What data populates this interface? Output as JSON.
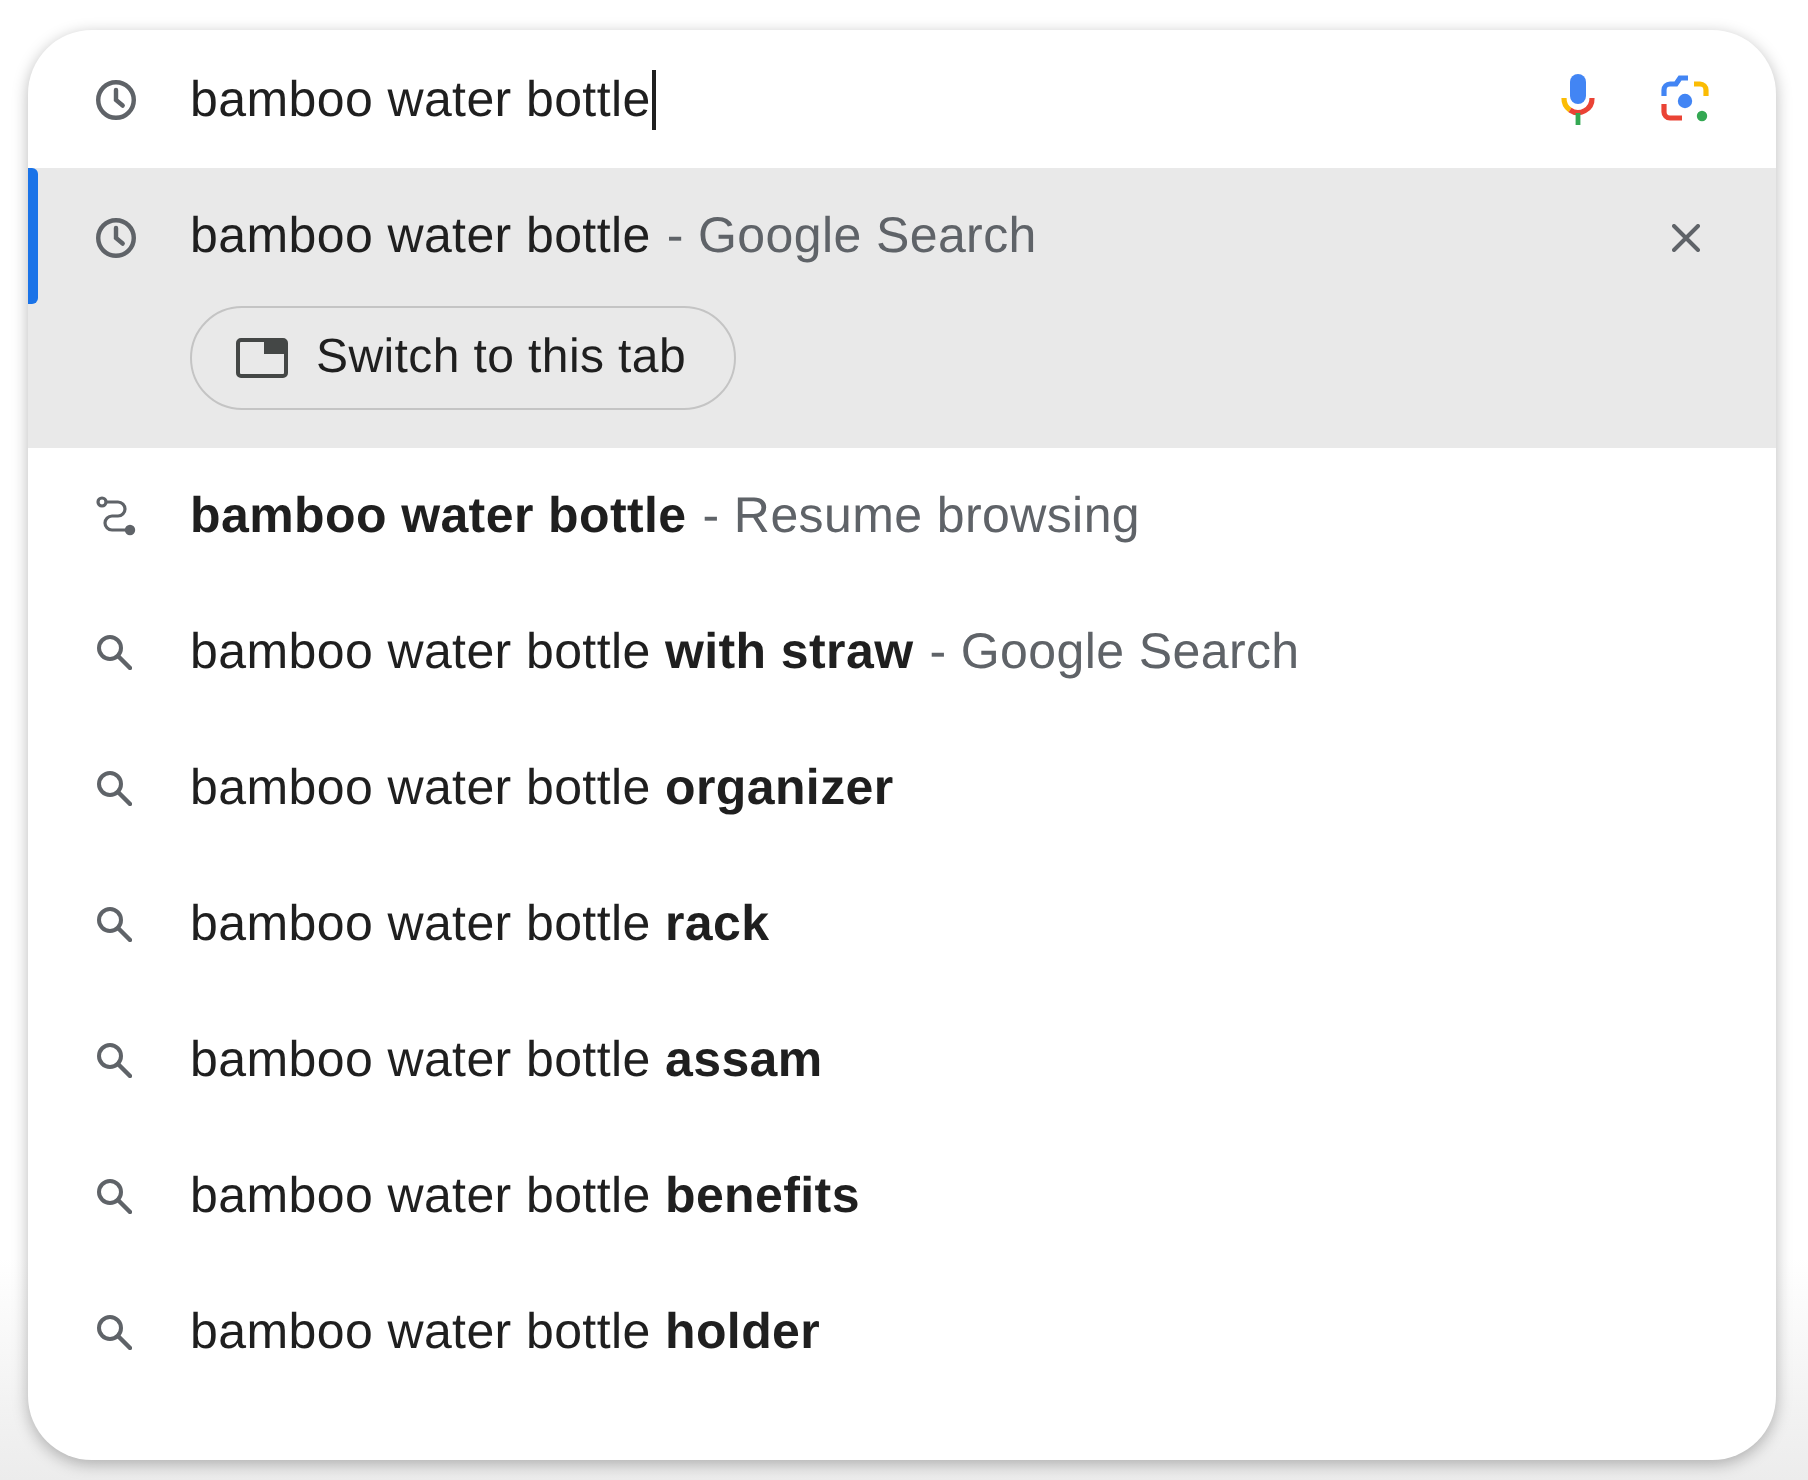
{
  "search_box": {
    "value": "bamboo water bottle",
    "focused": true
  },
  "suggestions": [
    {
      "kind": "history",
      "text": "bamboo water bottle",
      "bold": false,
      "description": "- Google Search",
      "selected": true,
      "action": "Switch to this tab"
    },
    {
      "kind": "journey",
      "text": "bamboo water bottle",
      "bold": true,
      "description": "- Resume browsing",
      "selected": false
    },
    {
      "kind": "search",
      "text": "bamboo water bottle **with straw**",
      "bold": false,
      "description": "- Google Search",
      "selected": false
    },
    {
      "kind": "search",
      "text": "bamboo water bottle **organizer**",
      "bold": false,
      "selected": false
    },
    {
      "kind": "search",
      "text": "bamboo water bottle **rack**",
      "bold": false,
      "selected": false
    },
    {
      "kind": "search",
      "text": "bamboo water bottle **assam**",
      "bold": false,
      "selected": false
    },
    {
      "kind": "search",
      "text": "bamboo water bottle **benefits**",
      "bold": false,
      "selected": false
    },
    {
      "kind": "search",
      "text": "bamboo water bottle **holder**",
      "bold": false,
      "selected": false
    }
  ]
}
